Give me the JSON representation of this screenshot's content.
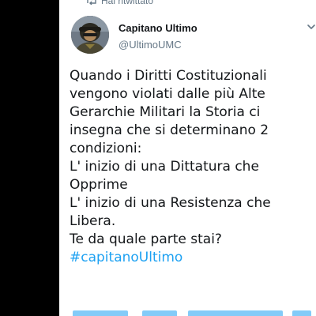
{
  "retweet": {
    "label": "Hai ritwittato",
    "icon": "retweet-icon"
  },
  "author": {
    "name": "Capitano Ultimo",
    "handle": "@UltimoUMC",
    "avatar_icon": "avatar-image"
  },
  "menu_icon": "chevron-down-icon",
  "tweet": {
    "lines": [
      "Quando i Diritti Costituzionali",
      "vengono violati dalle più Alte",
      "Gerarchie Militari la Storia ci",
      "insegna che si determinano 2",
      "condizioni:",
      "L' inizio di una Dittatura che",
      "Opprime",
      "L' inizio di una Resistenza che",
      "Libera.",
      "Te da quale parte stai?"
    ],
    "hashtag": "#capitanoUltimo"
  },
  "colors": {
    "text": "#14171a",
    "secondary": "#657786",
    "accent": "#1da1f2",
    "background": "#ffffff",
    "frame": "#000000"
  }
}
